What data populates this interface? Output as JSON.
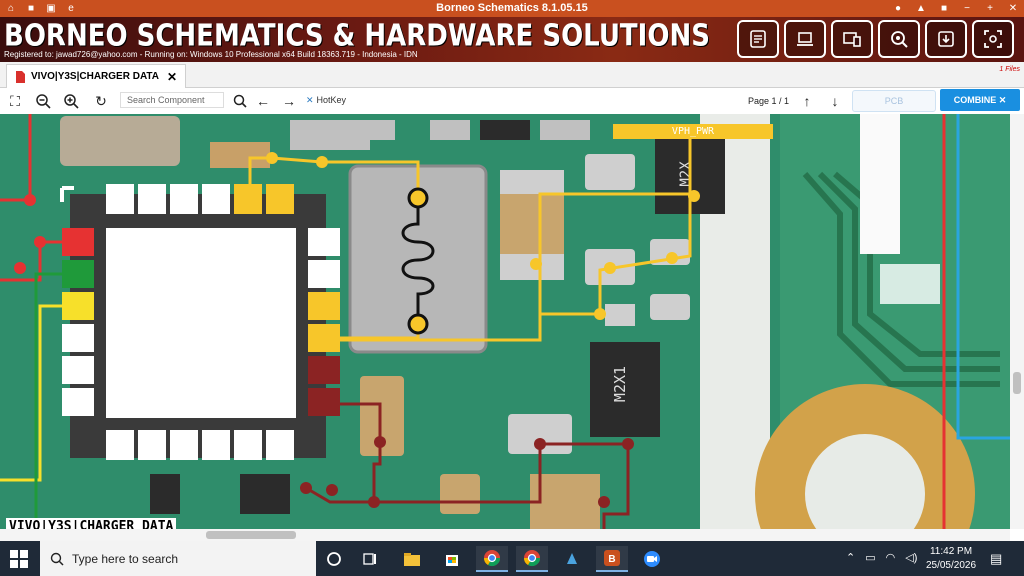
{
  "titlebar": {
    "title": "Borneo Schematics 8.1.05.15",
    "left_icons": [
      "home-icon",
      "save-icon",
      "save-as-icon",
      "edge-icon"
    ],
    "right_icons": [
      "user-icon",
      "lock-icon",
      "video-icon",
      "minimize-icon",
      "maximize-icon",
      "close-icon"
    ]
  },
  "banner": {
    "brand": "BORNEO SCHEMATICS & HARDWARE SOLUTIONS",
    "registration": "Registered to: jawad726@yahoo.com - Running on: Windows 10 Professional x64 Build 18363.719 - Indonesia - IDN",
    "tools": [
      "checklist-icon",
      "laptop-icon",
      "devices-icon",
      "search-chip-icon",
      "download-icon",
      "focus-icon"
    ]
  },
  "tabs": [
    {
      "label": "VIVO|Y3S|CHARGER DATA",
      "close": "✕"
    }
  ],
  "files_badge": "1 Files",
  "toolbar": {
    "search_placeholder": "Search Component",
    "hotkey_label": "HotKey",
    "page_info": "Page 1 / 1",
    "pcb_label": "PCB",
    "combine_label": "COMBINE"
  },
  "board": {
    "view_label": "VIVO|Y3S|CHARGER DATA",
    "net_label": "VPH_PWR",
    "component_markings": [
      "M2X",
      "M2X1"
    ],
    "colors": {
      "board": "#2f8d6b",
      "yellow_net": "#f7c62a",
      "dark_red_net": "#8b2323",
      "red_net": "#e63232",
      "blue_net": "#2aa5e0",
      "green_pad": "#1f9a3a"
    }
  },
  "taskbar": {
    "search_placeholder": "Type here to search",
    "apps": [
      "cortana-icon",
      "task-view-icon",
      "file-explorer-icon",
      "store-icon",
      "chrome-icon",
      "chrome-profile-icon",
      "app-icon",
      "borneo-icon",
      "zoom-icon"
    ],
    "time": "11:42 PM",
    "date": "25/05/2026"
  }
}
